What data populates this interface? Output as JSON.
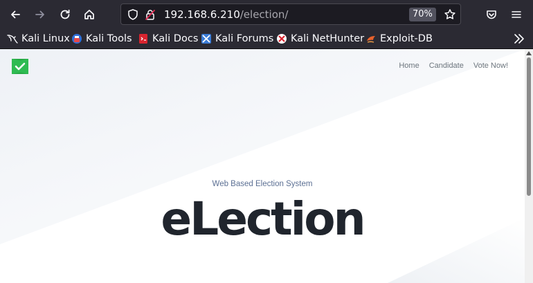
{
  "browser": {
    "url_host": "192.168.6.210",
    "url_path": "/election/",
    "zoom_level": "70%",
    "nav_icons": [
      "back-arrow-icon",
      "forward-arrow-icon",
      "reload-icon",
      "home-icon"
    ],
    "url_icons": [
      "shield-icon",
      "insecure-lock-icon",
      "bookmark-star-icon"
    ],
    "right_icons": [
      "pocket-icon",
      "menu-icon"
    ]
  },
  "bookmarks": [
    {
      "label": "Kali Linux",
      "icon": "kali-dragon-icon"
    },
    {
      "label": "Kali Tools",
      "icon": "kali-tools-icon"
    },
    {
      "label": "Kali Docs",
      "icon": "kali-docs-icon"
    },
    {
      "label": "Kali Forums",
      "icon": "kali-forums-icon"
    },
    {
      "label": "Kali NetHunter",
      "icon": "nethunter-icon"
    },
    {
      "label": "Exploit-DB",
      "icon": "exploit-db-icon"
    }
  ],
  "site": {
    "logo_icon": "checkmark-flag-logo-icon",
    "nav": [
      "Home",
      "Candidate",
      "Vote Now!"
    ],
    "subtitle": "Web Based Election System",
    "title": "eLection"
  },
  "colors": {
    "toolbar": "#2b2a33",
    "logo_green": "#27a844",
    "title": "#20252d",
    "subtitle": "#5b6f93",
    "nav_link": "#6c757d"
  }
}
